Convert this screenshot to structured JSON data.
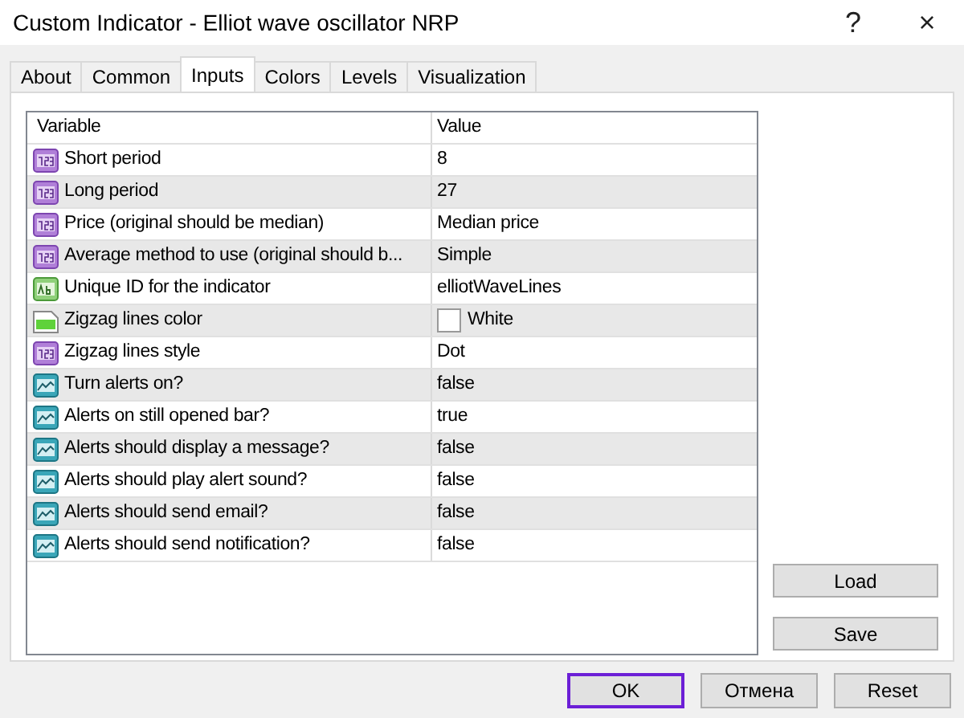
{
  "window": {
    "title": "Custom Indicator - Elliot wave oscillator NRP",
    "help": "?",
    "close": "×"
  },
  "tabs": [
    {
      "label": "About",
      "selected": false
    },
    {
      "label": "Common",
      "selected": false
    },
    {
      "label": "Inputs",
      "selected": true
    },
    {
      "label": "Colors",
      "selected": false
    },
    {
      "label": "Levels",
      "selected": false
    },
    {
      "label": "Visualization",
      "selected": false
    }
  ],
  "table": {
    "columns": [
      "Variable",
      "Value"
    ],
    "rows": [
      {
        "kind": "number",
        "variable": "Short period",
        "value": "8"
      },
      {
        "kind": "number",
        "variable": "Long period",
        "value": "27"
      },
      {
        "kind": "number",
        "variable": "Price (original should be median)",
        "value": "Median price"
      },
      {
        "kind": "number",
        "variable": "Average method to use (original should b...",
        "value": "Simple"
      },
      {
        "kind": "text",
        "variable": "Unique ID for the indicator",
        "value": "elliotWaveLines"
      },
      {
        "kind": "color",
        "variable": "Zigzag lines color",
        "value": "White",
        "color": "#ffffff"
      },
      {
        "kind": "number",
        "variable": "Zigzag lines style",
        "value": "Dot"
      },
      {
        "kind": "alert",
        "variable": "Turn alerts on?",
        "value": "false"
      },
      {
        "kind": "alert",
        "variable": "Alerts on still opened bar?",
        "value": "true"
      },
      {
        "kind": "alert",
        "variable": "Alerts should display a message?",
        "value": "false"
      },
      {
        "kind": "alert",
        "variable": "Alerts should play alert sound?",
        "value": "false"
      },
      {
        "kind": "alert",
        "variable": "Alerts should send email?",
        "value": "false"
      },
      {
        "kind": "alert",
        "variable": "Alerts should send notification?",
        "value": "false"
      }
    ]
  },
  "side_buttons": [
    "Load",
    "Save"
  ],
  "footer_buttons": [
    {
      "label": "OK",
      "focused": true
    },
    {
      "label": "Отмена",
      "focused": false
    },
    {
      "label": "Reset",
      "focused": false
    }
  ]
}
